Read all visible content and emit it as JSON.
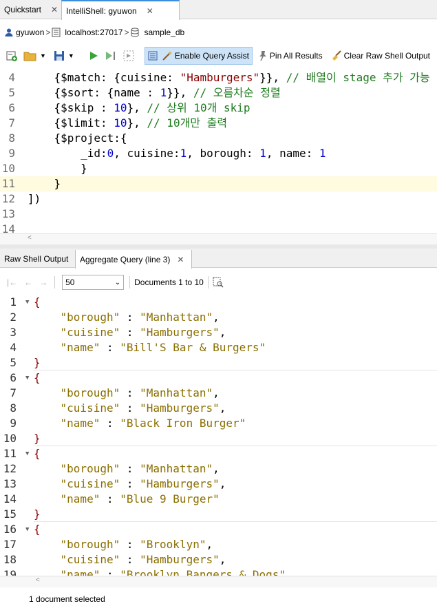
{
  "tabs": [
    {
      "label": "Quickstart",
      "close": "✕",
      "active": false
    },
    {
      "label": "IntelliShell: gyuwon",
      "close": "✕",
      "active": true
    }
  ],
  "breadcrumb": {
    "user": "gyuwon",
    "host": "localhost:27017",
    "db": "sample_db"
  },
  "toolbar": {
    "enable_assist": "Enable Query Assist",
    "pin_all": "Pin All Results",
    "clear_raw": "Clear Raw Shell Output"
  },
  "editor": {
    "lines": [
      {
        "n": "4",
        "parts": [
          [
            "k",
            "    {$match: {cuisine: "
          ],
          [
            "str",
            "\"Hamburgers\""
          ],
          [
            "k",
            "}}, "
          ],
          [
            "cmt",
            "// 배열이 stage 추가 가능"
          ]
        ]
      },
      {
        "n": "5",
        "parts": [
          [
            "k",
            "    {$sort: {name : "
          ],
          [
            "num",
            "1"
          ],
          [
            "k",
            "}}, "
          ],
          [
            "cmt",
            "// 오름차순 정렬"
          ]
        ]
      },
      {
        "n": "6",
        "parts": [
          [
            "k",
            "    {$skip : "
          ],
          [
            "num",
            "10"
          ],
          [
            "k",
            "}, "
          ],
          [
            "cmt",
            "// 상위 10개 skip"
          ]
        ]
      },
      {
        "n": "7",
        "parts": [
          [
            "k",
            "    {$limit: "
          ],
          [
            "num",
            "10"
          ],
          [
            "k",
            "}, "
          ],
          [
            "cmt",
            "// 10개만 출력"
          ]
        ]
      },
      {
        "n": "8",
        "parts": [
          [
            "k",
            "    {$project:{"
          ]
        ]
      },
      {
        "n": "9",
        "parts": [
          [
            "k",
            "        _id:"
          ],
          [
            "num",
            "0"
          ],
          [
            "k",
            ", cuisine:"
          ],
          [
            "num",
            "1"
          ],
          [
            "k",
            ", borough: "
          ],
          [
            "num",
            "1"
          ],
          [
            "k",
            ", name: "
          ],
          [
            "num",
            "1"
          ]
        ]
      },
      {
        "n": "10",
        "parts": [
          [
            "k",
            "        }"
          ]
        ]
      },
      {
        "n": "11",
        "parts": [
          [
            "k",
            "    }"
          ]
        ]
      },
      {
        "n": "12",
        "parts": [
          [
            "k",
            "])"
          ]
        ]
      },
      {
        "n": "13",
        "parts": []
      },
      {
        "n": "14",
        "parts": []
      }
    ]
  },
  "result_tabs": [
    {
      "label": "Raw Shell Output",
      "active": false
    },
    {
      "label": "Aggregate Query (line 3)",
      "close": "✕",
      "active": true
    }
  ],
  "nav": {
    "page_size": "50",
    "documents": "Documents 1 to 10"
  },
  "results": {
    "docs": [
      {
        "start": 1,
        "fields": [
          [
            "\"borough\"",
            "\"Manhattan\""
          ],
          [
            "\"cuisine\"",
            "\"Hamburgers\""
          ],
          [
            "\"name\"",
            "\"Bill'S Bar & Burgers\""
          ]
        ]
      },
      {
        "start": 6,
        "fields": [
          [
            "\"borough\"",
            "\"Manhattan\""
          ],
          [
            "\"cuisine\"",
            "\"Hamburgers\""
          ],
          [
            "\"name\"",
            "\"Black Iron Burger\""
          ]
        ]
      },
      {
        "start": 11,
        "fields": [
          [
            "\"borough\"",
            "\"Manhattan\""
          ],
          [
            "\"cuisine\"",
            "\"Hamburgers\""
          ],
          [
            "\"name\"",
            "\"Blue 9 Burger\""
          ]
        ]
      },
      {
        "start": 16,
        "fields": [
          [
            "\"borough\"",
            "\"Brooklyn\""
          ],
          [
            "\"cuisine\"",
            "\"Hamburgers\""
          ],
          [
            "\"name\"",
            "\"Brooklyn Bangers & Dogs\""
          ]
        ]
      }
    ]
  },
  "status": {
    "text": "1 document selected"
  }
}
